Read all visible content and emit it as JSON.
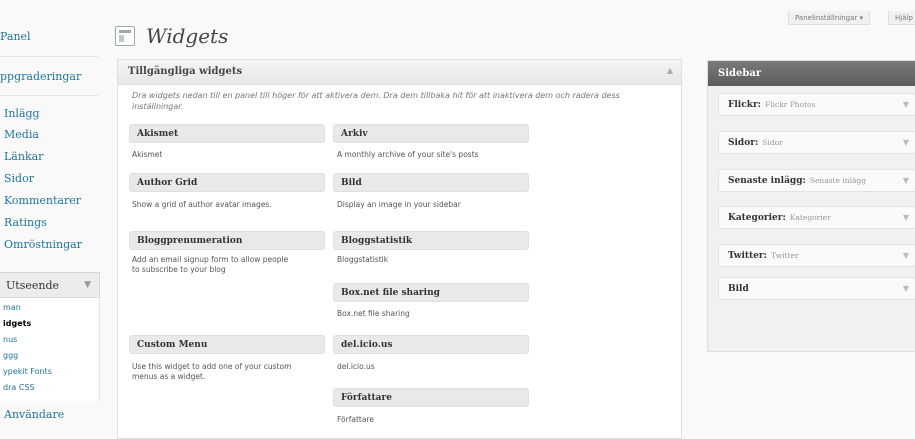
{
  "admin_menu": {
    "items": [
      {
        "label": "Panel"
      },
      {
        "label": "ppgraderingar"
      },
      {
        "label": "Inlägg"
      },
      {
        "label": "Media"
      },
      {
        "label": "Länkar"
      },
      {
        "label": "Sidor"
      },
      {
        "label": "Kommentarer"
      },
      {
        "label": "Ratings"
      },
      {
        "label": "Omröstningar"
      }
    ],
    "group": {
      "label": "Utseende",
      "arrow": "▼"
    },
    "submenu": [
      {
        "label": "man"
      },
      {
        "label": "idgets"
      },
      {
        "label": "nus"
      },
      {
        "label": "ggg"
      },
      {
        "label": "ypekit Fonts"
      },
      {
        "label": "dra CSS"
      }
    ],
    "after": {
      "label": "Användare"
    }
  },
  "header": {
    "title": "Widgets",
    "screen_options": "Panelinställningar ▾",
    "help": "Hjälp"
  },
  "available": {
    "title": "Tillgängliga widgets",
    "description": "Dra widgets nedan till en panel till höger för att aktivera dem. Dra dem tillbaka hit för att inaktivera dem och radera dess inställningar.",
    "widgets": [
      {
        "title": "Akismet",
        "desc": "Akismet"
      },
      {
        "title": "Arkiv",
        "desc": "A monthly archive of your site's posts"
      },
      {
        "title": "Author Grid",
        "desc": "Show a grid of author avatar images."
      },
      {
        "title": "Bild",
        "desc": "Display an image in your sidebar"
      },
      {
        "title": "Bloggprenumeration",
        "desc": "Add an email signup form to allow people to subscribe to your blog"
      },
      {
        "title": "Bloggstatistik",
        "desc": "Bloggstatistik"
      },
      {
        "title": "Box.net file sharing",
        "desc": "Box.net file sharing"
      },
      {
        "title": "Custom Menu",
        "desc": "Use this widget to add one of your custom menus as a widget."
      },
      {
        "title": "del.icio.us",
        "desc": "del.icio.us"
      },
      {
        "title": "Författare",
        "desc": "Författare"
      }
    ]
  },
  "sidebar_panel": {
    "title": "Sidebar",
    "widgets": [
      {
        "title": "Flickr:",
        "subtitle": "Flickr Photos"
      },
      {
        "title": "Sidor:",
        "subtitle": "Sidor"
      },
      {
        "title": "Senaste inlägg:",
        "subtitle": "Senaste inlägg"
      },
      {
        "title": "Kategorier:",
        "subtitle": "Kategorier"
      },
      {
        "title": "Twitter:",
        "subtitle": "Twitter"
      },
      {
        "title": "Bild",
        "subtitle": ""
      }
    ],
    "arrow": "▼"
  },
  "toggle_icon": "▲"
}
